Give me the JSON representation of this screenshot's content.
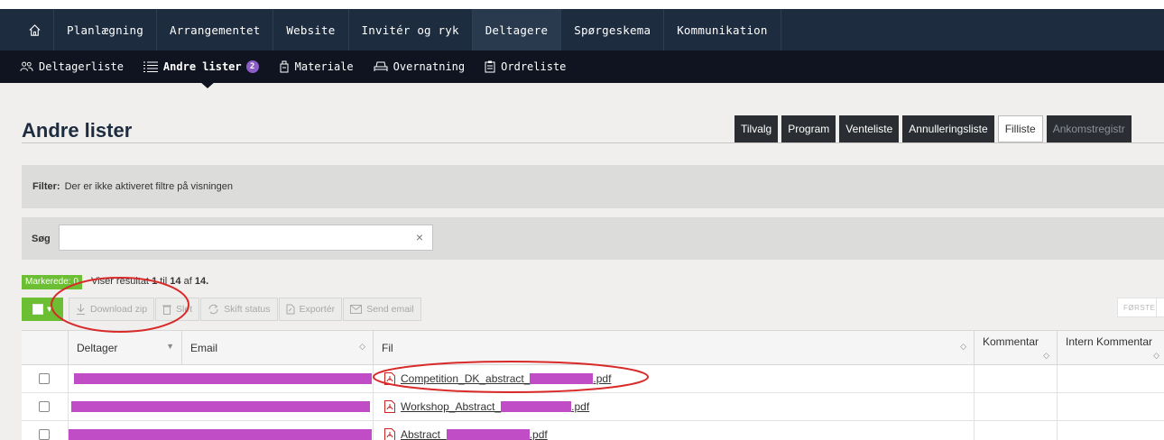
{
  "nav": {
    "home_icon": "home-icon",
    "items": [
      {
        "label": "Planlægning"
      },
      {
        "label": "Arrangementet"
      },
      {
        "label": "Website"
      },
      {
        "label": "Invitér og ryk"
      },
      {
        "label": "Deltagere",
        "active": true
      },
      {
        "label": "Spørgeskema"
      },
      {
        "label": "Kommunikation"
      }
    ]
  },
  "subnav": {
    "items": [
      {
        "label": "Deltagerliste",
        "icon": "people-icon"
      },
      {
        "label": "Andre lister",
        "icon": "list-icon",
        "badge": "2",
        "active": true
      },
      {
        "label": "Materiale",
        "icon": "material-icon"
      },
      {
        "label": "Overnatning",
        "icon": "bed-icon"
      },
      {
        "label": "Ordreliste",
        "icon": "clipboard-icon"
      }
    ]
  },
  "page": {
    "title": "Andre lister"
  },
  "tabs": [
    {
      "label": "Tilvalg"
    },
    {
      "label": "Program"
    },
    {
      "label": "Venteliste"
    },
    {
      "label": "Annulleringsliste"
    },
    {
      "label": "Filliste",
      "active": true
    },
    {
      "label": "Ankomstregistr",
      "disabled": true
    }
  ],
  "filter": {
    "label": "Filter:",
    "text": "Der er ikke aktiveret filtre på visningen"
  },
  "search": {
    "label": "Søg",
    "value": "",
    "clear_icon": "×"
  },
  "selection": {
    "marked_label": "Markerede: 0",
    "showing_prefix": "Viser resultat",
    "from": "1",
    "to_word": "til",
    "to": "14",
    "of_word": "af",
    "total": "14."
  },
  "toolbar": {
    "download_zip": "Download zip",
    "delete": "Slet",
    "change_status": "Skift status",
    "export": "Exportér",
    "send_email": "Send email"
  },
  "pager": {
    "first": "FØRSTE"
  },
  "table": {
    "headers": {
      "participant": "Deltager",
      "email": "Email",
      "file": "Fil",
      "comment": "Kommentar",
      "internal_comment": "Intern Kommentar"
    },
    "rows": [
      {
        "file": "Competition_DK_abstract_",
        "file_suffix": ".pdf"
      },
      {
        "file": "Workshop_Abstract_",
        "file_suffix": ".pdf"
      },
      {
        "file": "Abstract_",
        "file_suffix": ".pdf"
      }
    ]
  },
  "colors": {
    "nav_bg": "#1d2c3f",
    "subnav_bg": "#0f1420",
    "accent_green": "#6cbe33",
    "badge_purple": "#8c5cc7",
    "redaction": "#c04dc6",
    "annotation_red": "#d92a2a"
  }
}
